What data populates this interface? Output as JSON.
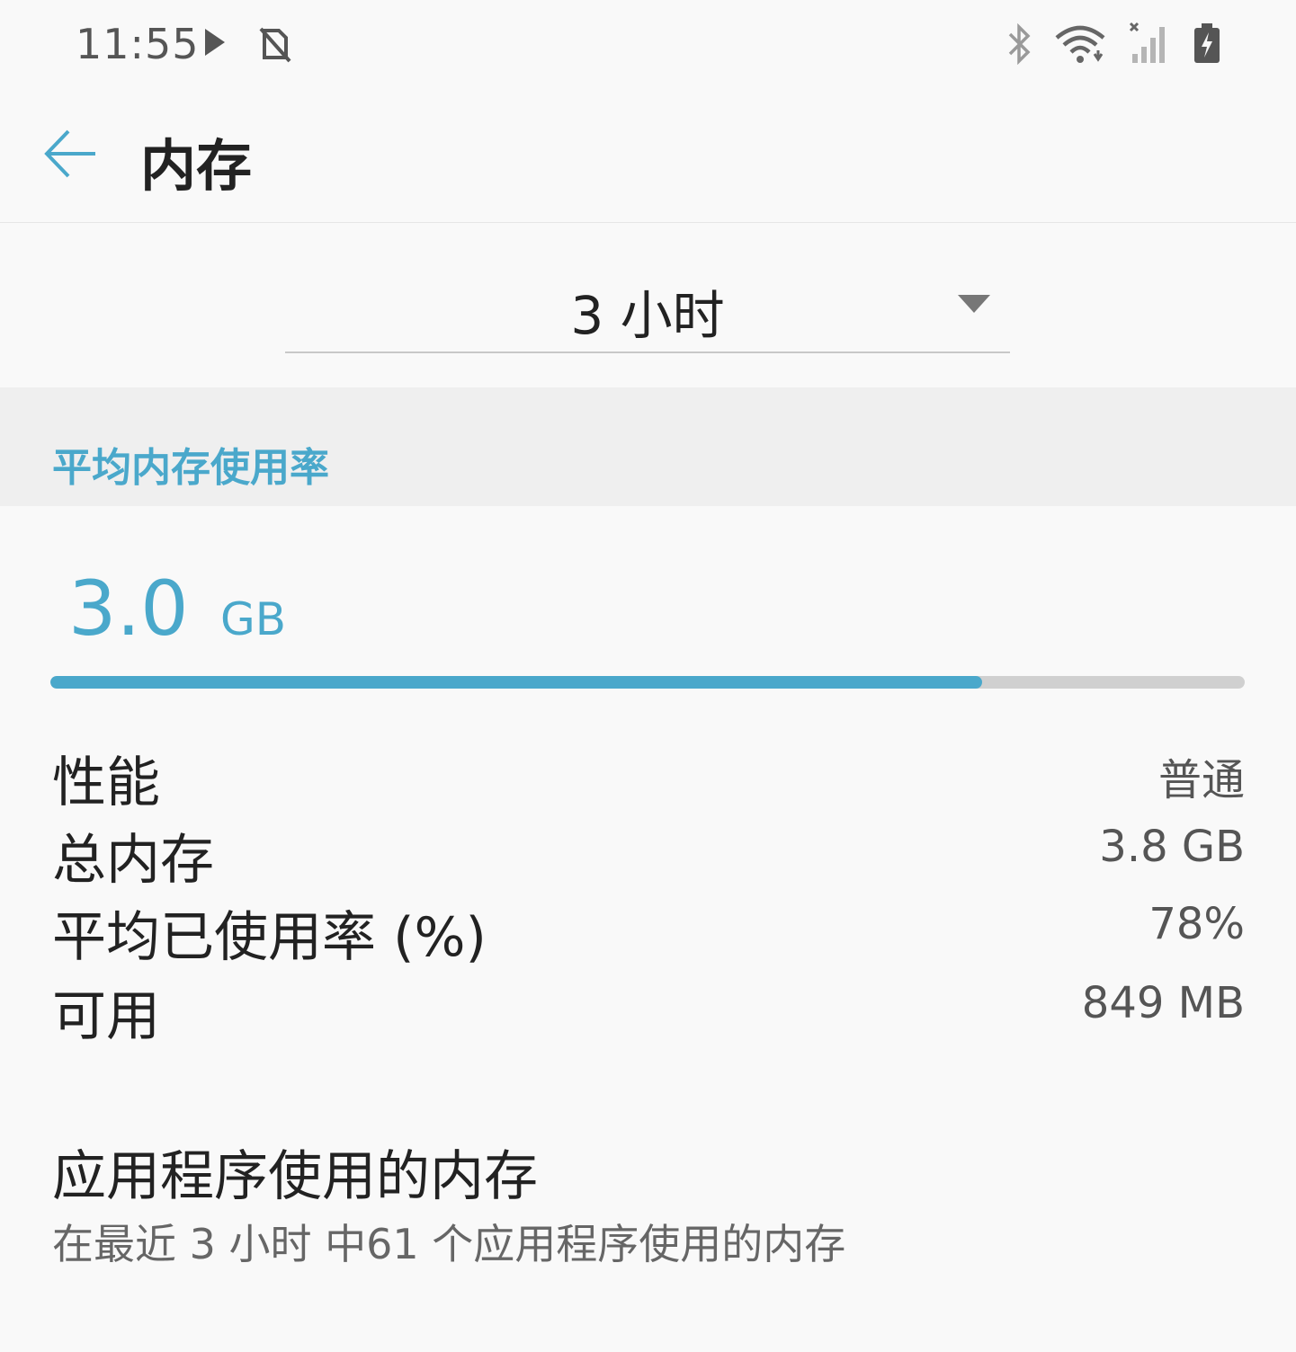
{
  "status_bar": {
    "time": "11:55",
    "left_icons": [
      "play-icon",
      "no-sim-icon"
    ],
    "right_icons": [
      "bluetooth-icon",
      "wifi-icon",
      "cell-signal-icon",
      "battery-charging-icon"
    ]
  },
  "app_bar": {
    "title": "内存"
  },
  "period_dropdown": {
    "selected": "3 小时"
  },
  "section": {
    "header": "平均内存使用率"
  },
  "usage": {
    "value": "3.0",
    "unit": "GB",
    "progress_fraction": 0.78
  },
  "stats": [
    {
      "label": "性能",
      "value": "普通"
    },
    {
      "label": "总内存",
      "value": "3.8 GB"
    },
    {
      "label": "平均已使用率 (%)",
      "value": "78%"
    },
    {
      "label": "可用",
      "value": "849 MB"
    }
  ],
  "apps_section": {
    "title": "应用程序使用的内存",
    "subtitle": "在最近 3 小时 中61 个应用程序使用的内存"
  },
  "colors": {
    "accent": "#4aa8cb",
    "track": "#d0d0d0",
    "section_bg": "#efefef",
    "page_bg": "#f9f9f9"
  }
}
